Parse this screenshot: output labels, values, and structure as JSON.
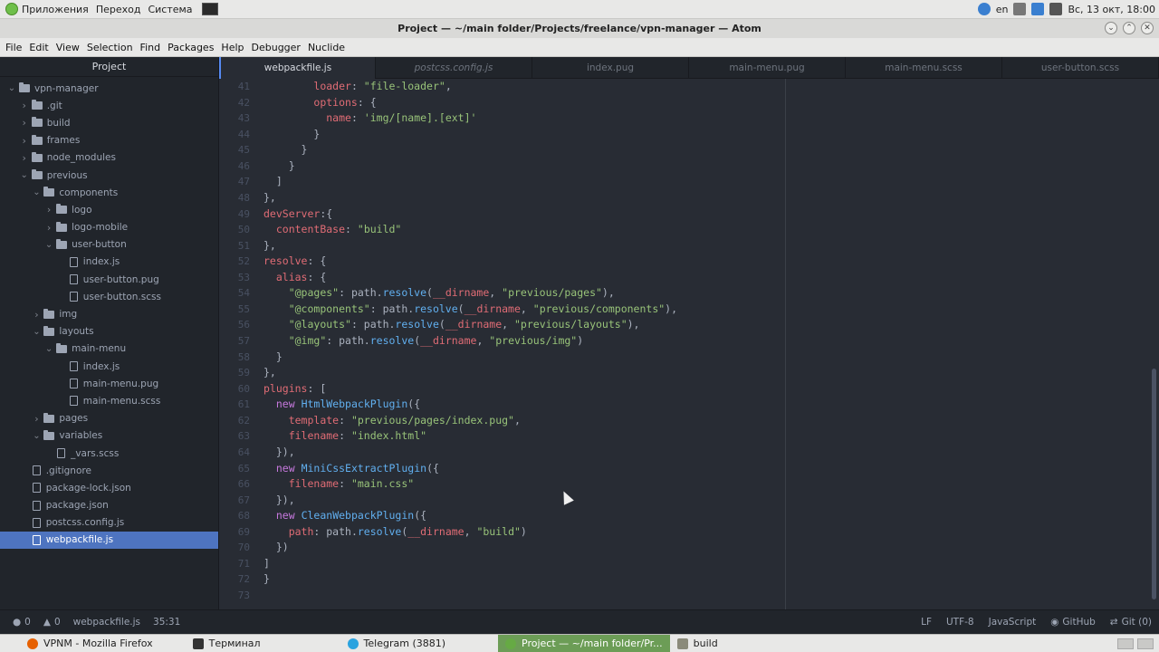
{
  "system_panel": {
    "menus": [
      "Приложения",
      "Переход",
      "Система"
    ],
    "keyboard_layout": "en",
    "datetime": "Вс, 13 окт, 18:00"
  },
  "window": {
    "title": "Project — ~/main folder/Projects/freelance/vpn-manager — Atom"
  },
  "menubar": {
    "items": [
      "File",
      "Edit",
      "View",
      "Selection",
      "Find",
      "Packages",
      "Help",
      "Debugger",
      "Nuclide"
    ]
  },
  "tree": {
    "header": "Project",
    "items": [
      {
        "label": "vpn-manager",
        "type": "folder",
        "depth": 0,
        "expanded": true
      },
      {
        "label": ".git",
        "type": "folder",
        "depth": 1,
        "expanded": false
      },
      {
        "label": "build",
        "type": "folder",
        "depth": 1,
        "expanded": false
      },
      {
        "label": "frames",
        "type": "folder",
        "depth": 1,
        "expanded": false
      },
      {
        "label": "node_modules",
        "type": "folder",
        "depth": 1,
        "expanded": false
      },
      {
        "label": "previous",
        "type": "folder",
        "depth": 1,
        "expanded": true
      },
      {
        "label": "components",
        "type": "folder",
        "depth": 2,
        "expanded": true
      },
      {
        "label": "logo",
        "type": "folder",
        "depth": 3,
        "expanded": false
      },
      {
        "label": "logo-mobile",
        "type": "folder",
        "depth": 3,
        "expanded": false
      },
      {
        "label": "user-button",
        "type": "folder",
        "depth": 3,
        "expanded": true
      },
      {
        "label": "index.js",
        "type": "file",
        "depth": 4
      },
      {
        "label": "user-button.pug",
        "type": "file",
        "depth": 4
      },
      {
        "label": "user-button.scss",
        "type": "file",
        "depth": 4
      },
      {
        "label": "img",
        "type": "folder",
        "depth": 2,
        "expanded": false
      },
      {
        "label": "layouts",
        "type": "folder",
        "depth": 2,
        "expanded": true
      },
      {
        "label": "main-menu",
        "type": "folder",
        "depth": 3,
        "expanded": true
      },
      {
        "label": "index.js",
        "type": "file",
        "depth": 4
      },
      {
        "label": "main-menu.pug",
        "type": "file",
        "depth": 4
      },
      {
        "label": "main-menu.scss",
        "type": "file",
        "depth": 4
      },
      {
        "label": "pages",
        "type": "folder",
        "depth": 2,
        "expanded": false
      },
      {
        "label": "variables",
        "type": "folder",
        "depth": 2,
        "expanded": true
      },
      {
        "label": "_vars.scss",
        "type": "file",
        "depth": 3
      },
      {
        "label": ".gitignore",
        "type": "file",
        "depth": 1
      },
      {
        "label": "package-lock.json",
        "type": "file",
        "depth": 1
      },
      {
        "label": "package.json",
        "type": "file",
        "depth": 1
      },
      {
        "label": "postcss.config.js",
        "type": "file",
        "depth": 1
      },
      {
        "label": "webpackfile.js",
        "type": "file",
        "depth": 1,
        "selected": true
      }
    ]
  },
  "tabs": [
    {
      "label": "webpackfile.js",
      "active": true,
      "italic": false
    },
    {
      "label": "postcss.config.js",
      "active": false,
      "italic": true
    },
    {
      "label": "index.pug",
      "active": false,
      "italic": false
    },
    {
      "label": "main-menu.pug",
      "active": false,
      "italic": false
    },
    {
      "label": "main-menu.scss",
      "active": false,
      "italic": false
    },
    {
      "label": "user-button.scss",
      "active": false,
      "italic": false
    }
  ],
  "editor": {
    "first_line": 41,
    "lines": [
      [
        [
          "x",
          "        "
        ],
        [
          "p",
          "loader"
        ],
        [
          "x",
          ": "
        ],
        [
          "s",
          "\"file-loader\""
        ],
        [
          "x",
          ","
        ]
      ],
      [
        [
          "x",
          "        "
        ],
        [
          "p",
          "options"
        ],
        [
          "x",
          ": {"
        ]
      ],
      [
        [
          "x",
          "          "
        ],
        [
          "p",
          "name"
        ],
        [
          "x",
          ": "
        ],
        [
          "s",
          "'img/[name].[ext]'"
        ]
      ],
      [
        [
          "x",
          "        }"
        ]
      ],
      [
        [
          "x",
          "      }"
        ]
      ],
      [
        [
          "x",
          "    }"
        ]
      ],
      [
        [
          "x",
          "  ]"
        ]
      ],
      [
        [
          "x",
          "},"
        ]
      ],
      [
        [
          "p",
          "devServer"
        ],
        [
          "x",
          ":{"
        ]
      ],
      [
        [
          "x",
          "  "
        ],
        [
          "p",
          "contentBase"
        ],
        [
          "x",
          ": "
        ],
        [
          "s",
          "\"build\""
        ]
      ],
      [
        [
          "x",
          "},"
        ]
      ],
      [
        [
          "p",
          "resolve"
        ],
        [
          "x",
          ": {"
        ]
      ],
      [
        [
          "x",
          "  "
        ],
        [
          "p",
          "alias"
        ],
        [
          "x",
          ": {"
        ]
      ],
      [
        [
          "x",
          "    "
        ],
        [
          "s",
          "\"@pages\""
        ],
        [
          "x",
          ": path."
        ],
        [
          "f",
          "resolve"
        ],
        [
          "x",
          "("
        ],
        [
          "p",
          "__dirname"
        ],
        [
          "x",
          ", "
        ],
        [
          "s",
          "\"previous/pages\""
        ],
        [
          "x",
          "),"
        ]
      ],
      [
        [
          "x",
          "    "
        ],
        [
          "s",
          "\"@components\""
        ],
        [
          "x",
          ": path."
        ],
        [
          "f",
          "resolve"
        ],
        [
          "x",
          "("
        ],
        [
          "p",
          "__dirname"
        ],
        [
          "x",
          ", "
        ],
        [
          "s",
          "\"previous/components\""
        ],
        [
          "x",
          "),"
        ]
      ],
      [
        [
          "x",
          "    "
        ],
        [
          "s",
          "\"@layouts\""
        ],
        [
          "x",
          ": path."
        ],
        [
          "f",
          "resolve"
        ],
        [
          "x",
          "("
        ],
        [
          "p",
          "__dirname"
        ],
        [
          "x",
          ", "
        ],
        [
          "s",
          "\"previous/layouts\""
        ],
        [
          "x",
          "),"
        ]
      ],
      [
        [
          "x",
          "    "
        ],
        [
          "s",
          "\"@img\""
        ],
        [
          "x",
          ": path."
        ],
        [
          "f",
          "resolve"
        ],
        [
          "x",
          "("
        ],
        [
          "p",
          "__dirname"
        ],
        [
          "x",
          ", "
        ],
        [
          "s",
          "\"previous/img\""
        ],
        [
          "x",
          ")"
        ]
      ],
      [
        [
          "x",
          "  }"
        ]
      ],
      [
        [
          "x",
          "},"
        ]
      ],
      [
        [
          "p",
          "plugins"
        ],
        [
          "x",
          ": ["
        ]
      ],
      [
        [
          "x",
          "  "
        ],
        [
          "k",
          "new"
        ],
        [
          "x",
          " "
        ],
        [
          "f",
          "HtmlWebpackPlugin"
        ],
        [
          "x",
          "({"
        ]
      ],
      [
        [
          "x",
          "    "
        ],
        [
          "p",
          "template"
        ],
        [
          "x",
          ": "
        ],
        [
          "s",
          "\"previous/pages/index.pug\""
        ],
        [
          "x",
          ","
        ]
      ],
      [
        [
          "x",
          "    "
        ],
        [
          "p",
          "filename"
        ],
        [
          "x",
          ": "
        ],
        [
          "s",
          "\"index.html\""
        ]
      ],
      [
        [
          "x",
          "  }),"
        ]
      ],
      [
        [
          "x",
          "  "
        ],
        [
          "k",
          "new"
        ],
        [
          "x",
          " "
        ],
        [
          "f",
          "MiniCssExtractPlugin"
        ],
        [
          "x",
          "({"
        ]
      ],
      [
        [
          "x",
          "    "
        ],
        [
          "p",
          "filename"
        ],
        [
          "x",
          ": "
        ],
        [
          "s",
          "\"main.css\""
        ]
      ],
      [
        [
          "x",
          "  }),"
        ]
      ],
      [
        [
          "x",
          "  "
        ],
        [
          "k",
          "new"
        ],
        [
          "x",
          " "
        ],
        [
          "f",
          "CleanWebpackPlugin"
        ],
        [
          "x",
          "({"
        ]
      ],
      [
        [
          "x",
          "    "
        ],
        [
          "p",
          "path"
        ],
        [
          "x",
          ": path."
        ],
        [
          "f",
          "resolve"
        ],
        [
          "x",
          "("
        ],
        [
          "p",
          "__dirname"
        ],
        [
          "x",
          ", "
        ],
        [
          "s",
          "\"build\""
        ],
        [
          "x",
          ")"
        ]
      ],
      [
        [
          "x",
          "  })"
        ]
      ],
      [
        [
          "x",
          "]"
        ]
      ],
      [
        [
          "x",
          "}"
        ]
      ],
      [
        [
          "x",
          ""
        ]
      ]
    ]
  },
  "status": {
    "errors": "0",
    "warnings": "0",
    "file": "webpackfile.js",
    "cursor": "35:31",
    "line_ending": "LF",
    "encoding": "UTF-8",
    "grammar": "JavaScript",
    "github": "GitHub",
    "git": "Git (0)"
  },
  "taskbar": {
    "tasks": [
      {
        "label": "VPNM - Mozilla Firefox",
        "icon": "firefox-icon",
        "active": false,
        "color": "#e66000"
      },
      {
        "label": "Терминал",
        "icon": "terminal-icon",
        "active": false,
        "color": "#333333"
      },
      {
        "label": "Telegram (3881)",
        "icon": "telegram-icon",
        "active": false,
        "color": "#2aa3df"
      },
      {
        "label": "Project — ~/main folder/Pr...",
        "icon": "atom-icon",
        "active": true,
        "color": "#66aa44"
      },
      {
        "label": "build",
        "icon": "folder-icon",
        "active": false,
        "color": "#8a8a7a"
      }
    ]
  }
}
